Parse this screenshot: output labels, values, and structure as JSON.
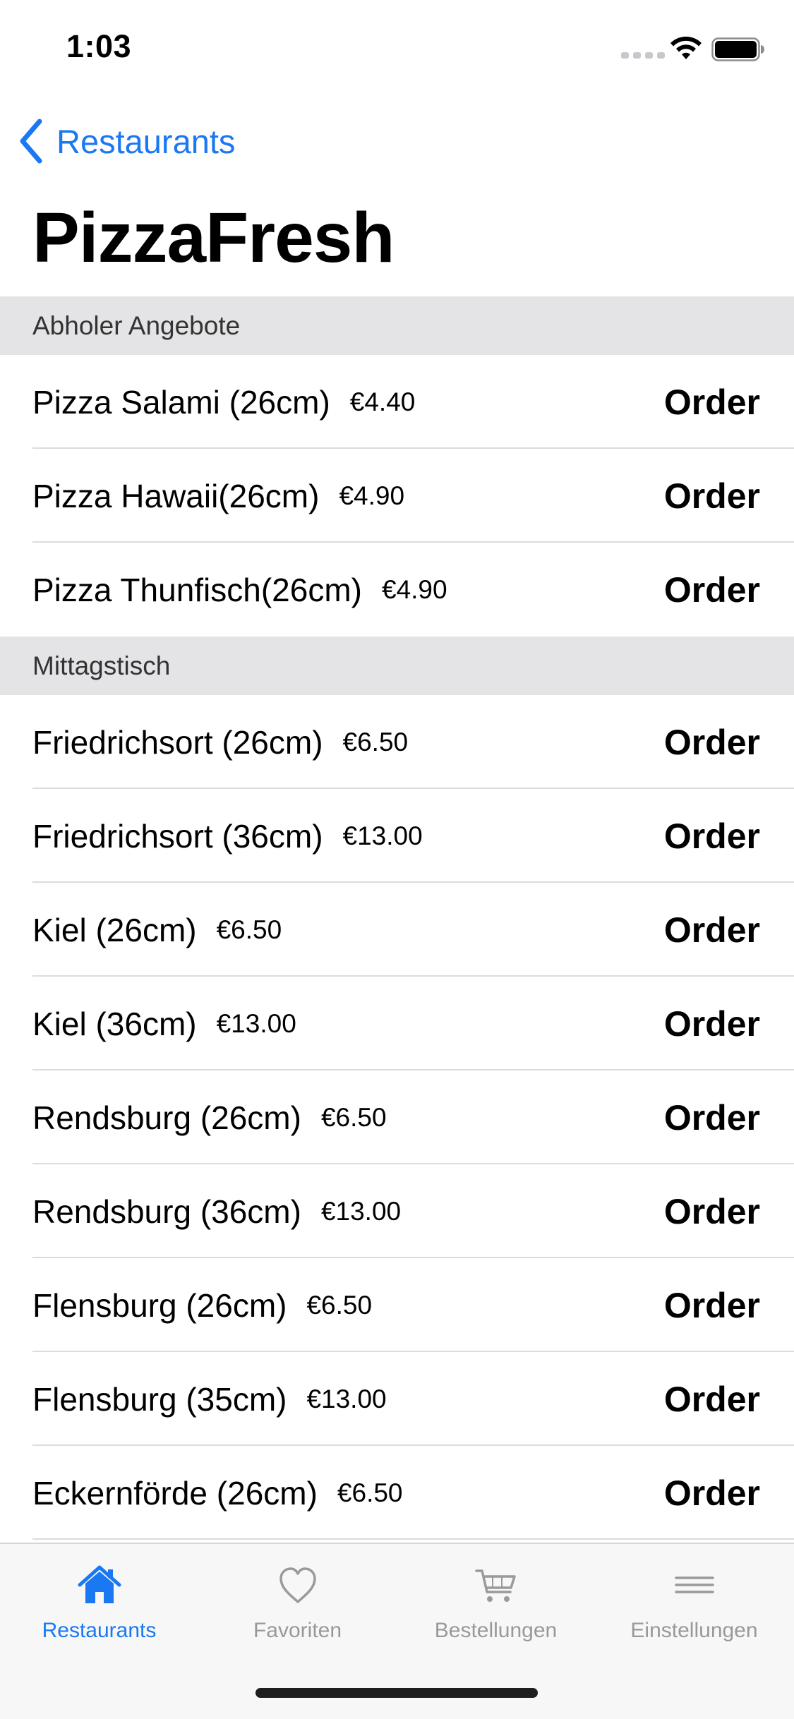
{
  "status_bar": {
    "time": "1:03"
  },
  "nav": {
    "back_label": "Restaurants",
    "title": "PizzaFresh"
  },
  "sections": [
    {
      "header": "Abholer Angebote",
      "items": [
        {
          "name": "Pizza Salami (26cm)",
          "price": "€4.40",
          "action": "Order"
        },
        {
          "name": "Pizza Hawaii(26cm)",
          "price": "€4.90",
          "action": "Order"
        },
        {
          "name": "Pizza Thunfisch(26cm)",
          "price": "€4.90",
          "action": "Order"
        }
      ]
    },
    {
      "header": "Mittagstisch",
      "items": [
        {
          "name": "Friedrichsort (26cm)",
          "price": "€6.50",
          "action": "Order"
        },
        {
          "name": "Friedrichsort (36cm)",
          "price": "€13.00",
          "action": "Order"
        },
        {
          "name": "Kiel (26cm)",
          "price": "€6.50",
          "action": "Order"
        },
        {
          "name": "Kiel (36cm)",
          "price": "€13.00",
          "action": "Order"
        },
        {
          "name": "Rendsburg (26cm)",
          "price": "€6.50",
          "action": "Order"
        },
        {
          "name": "Rendsburg (36cm)",
          "price": "€13.00",
          "action": "Order"
        },
        {
          "name": "Flensburg (26cm)",
          "price": "€6.50",
          "action": "Order"
        },
        {
          "name": "Flensburg (35cm)",
          "price": "€13.00",
          "action": "Order"
        },
        {
          "name": "Eckernförde (26cm)",
          "price": "€6.50",
          "action": "Order"
        }
      ]
    }
  ],
  "tab_bar": {
    "tabs": [
      {
        "label": "Restaurants",
        "icon": "house-icon",
        "active": true
      },
      {
        "label": "Favoriten",
        "icon": "heart-icon",
        "active": false
      },
      {
        "label": "Bestellungen",
        "icon": "cart-icon",
        "active": false
      },
      {
        "label": "Einstellungen",
        "icon": "menu-icon",
        "active": false
      }
    ]
  },
  "colors": {
    "accent": "#1a78f2",
    "section_header_bg": "#e4e4e6",
    "inactive_tab": "#999999"
  }
}
